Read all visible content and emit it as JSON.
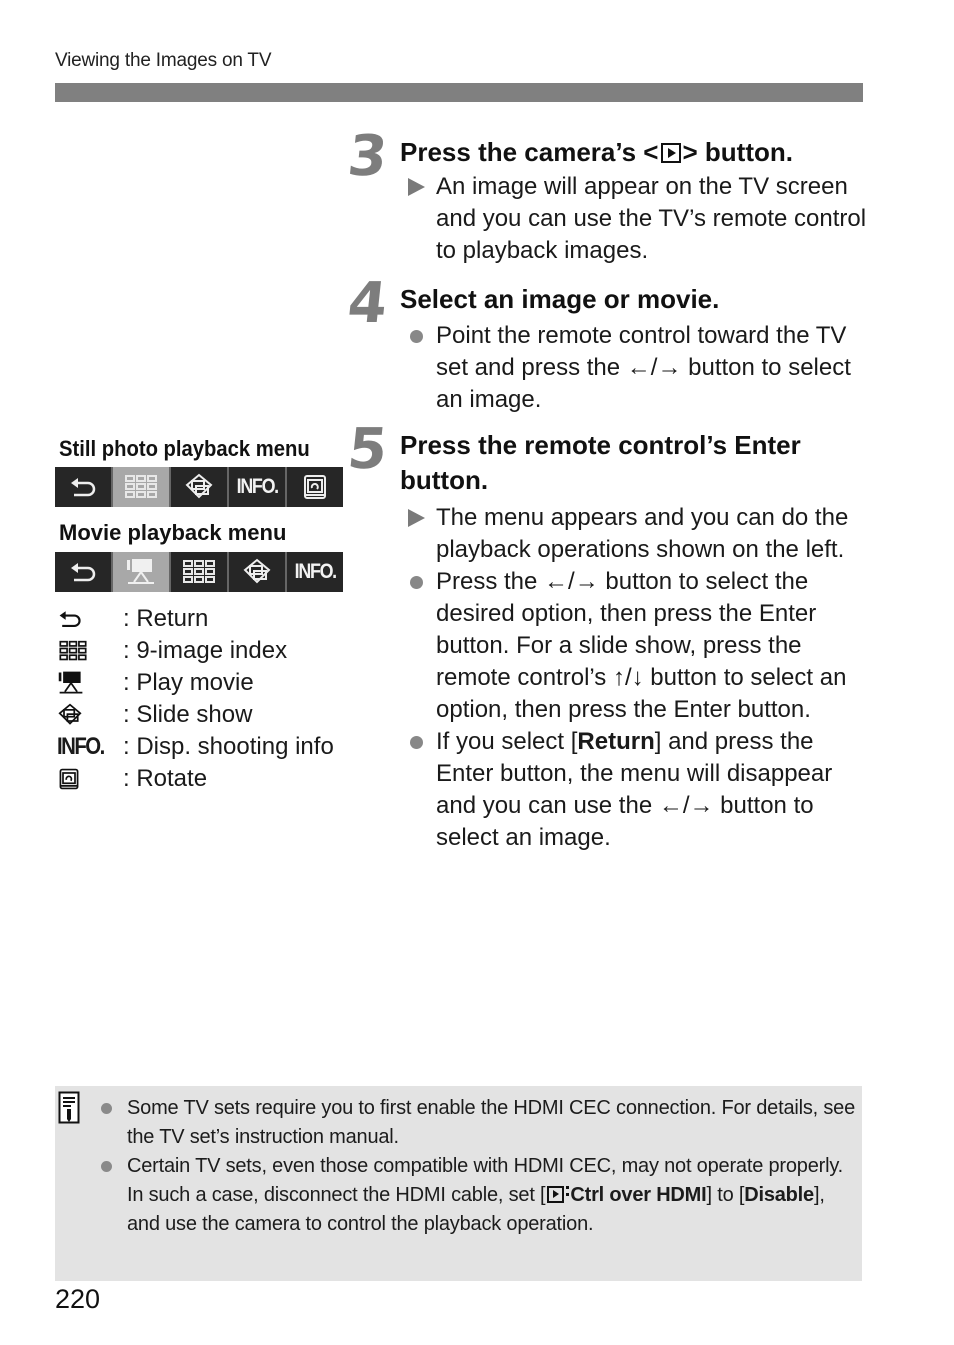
{
  "header": {
    "running_title": "Viewing the Images on TV"
  },
  "steps": [
    {
      "number": "3",
      "title_before": "Press the camera’s <",
      "title_icon": "playback-button-icon",
      "title_after": "> button.",
      "items": [
        {
          "marker": "triangle",
          "text": "An image will appear on the TV screen and you can use the TV’s remote control to playback images."
        }
      ]
    },
    {
      "number": "4",
      "title": "Select an image or movie.",
      "items": [
        {
          "marker": "dot",
          "text": "Point the remote control toward the TV set and press the ←/→ button to select an image."
        }
      ]
    },
    {
      "number": "5",
      "title": "Press the remote control’s Enter button.",
      "items": [
        {
          "marker": "triangle",
          "text": "The menu appears and you can do the playback operations shown on the left."
        },
        {
          "marker": "dot",
          "text": "Press the ←/→ button to select the desired option, then press the Enter button. For a slide show, press the remote control’s ↑/↓ button to select an option, then press the Enter button."
        },
        {
          "marker": "dot",
          "text_before": "If you select [",
          "bold": "Return",
          "text_after": "] and press the Enter button, the menu will disappear and you can use the ←/→ button to select an image."
        }
      ]
    }
  ],
  "menus": {
    "still": {
      "label": "Still photo playback menu",
      "icons": [
        "return-icon",
        "9-image-index-icon",
        "slide-show-icon",
        "info-icon",
        "rotate-icon"
      ],
      "active_index": 1
    },
    "movie": {
      "label": "Movie playback menu",
      "icons": [
        "return-icon",
        "play-movie-icon",
        "9-image-index-icon",
        "slide-show-icon",
        "info-icon"
      ],
      "active_index": 1
    },
    "info_text": "INFO."
  },
  "legend": [
    {
      "icon": "return-icon",
      "text": ": Return"
    },
    {
      "icon": "9-image-index-icon",
      "text": ": 9-image index"
    },
    {
      "icon": "play-movie-icon",
      "text": ": Play movie"
    },
    {
      "icon": "slide-show-icon",
      "text": ": Slide show"
    },
    {
      "icon": "info-icon",
      "icon_text": "INFO.",
      "text": ": Disp. shooting info"
    },
    {
      "icon": "rotate-icon",
      "text": ": Rotate"
    }
  ],
  "note": {
    "icon": "memo-icon",
    "items": [
      {
        "text": "Some TV sets require you to first enable the HDMI CEC connection. For details, see the TV set’s instruction manual."
      },
      {
        "text_1": "Certain TV sets, even those compatible with HDMI CEC, may not operate properly. In such a case, disconnect the HDMI cable, set [",
        "bold_1": "Ctrl over HDMI",
        "text_2": "] to [",
        "bold_2": "Disable",
        "text_3": "], and use the camera to control the playback operation."
      }
    ]
  },
  "footer": {
    "page_number": "220"
  }
}
